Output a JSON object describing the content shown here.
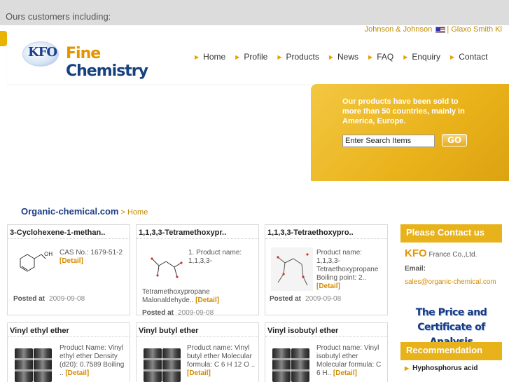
{
  "top": {
    "customers_label": "Ours customers including:",
    "customers": [
      "Johnson & Johnson",
      "|",
      "Glaxo Smith Kl"
    ]
  },
  "logo": {
    "badge": "KFO",
    "word1": "Fine",
    "word2": "Chemistry"
  },
  "nav": {
    "items": [
      "Home",
      "Profile",
      "Products",
      "News",
      "FAQ",
      "Enquiry",
      "Contact"
    ]
  },
  "promo": {
    "text": "Our products have been sold to more than 50 countries, mainly in America, Europe.",
    "search_value": "Enter Search Items",
    "go_label": "GO"
  },
  "breadcrumb": {
    "site": "Organic-chemical.com",
    "sep": " > ",
    "current": "Home"
  },
  "products": [
    {
      "title": "3-Cyclohexene-1-methan..",
      "desc": "CAS No.: 1679-51-2",
      "detail": "[Detail]",
      "posted_label": "Posted at",
      "date": "2009-09-08"
    },
    {
      "title": "1,1,3,3-Tetramethoxypr..",
      "desc_top": "1. Product name: 1,1,3,3-",
      "desc_bottom": "Tetramethoxypropane Malonaldehyde..",
      "detail": "[Detail]",
      "posted_label": "Posted at",
      "date": "2009-09-08"
    },
    {
      "title": "1,1,3,3-Tetraethoxypro..",
      "desc": "Product name: 1,1,3,3-Tetraethoxypropane Boiling point: 2..",
      "detail": "[Detail]",
      "posted_label": "Posted at",
      "date": "2009-09-08"
    },
    {
      "title": "Vinyl ethyl ether",
      "desc": "Product Name: Vinyl ethyl ether Density (d20): 0.7589 Boiling ..",
      "detail": "[Detail]"
    },
    {
      "title": "Vinyl butyl ether",
      "desc": "Product name: Vinyl butyl ether Molecular formula: C 6 H 12 O ..",
      "detail": "[Detail]"
    },
    {
      "title": "Vinyl isobutyl ether",
      "desc": "Product name: Vinyl isobutyl ether Molecular formula: C 6 H..",
      "detail": "[Detail]"
    }
  ],
  "sidebar": {
    "contact_header": "Please Contact us",
    "company_kfo": "KFO",
    "company_rest": "France Co.,Ltd.",
    "email_label": "Email:",
    "email": "sales@organic-chemical.com",
    "price_banner_line1": "The Price and",
    "price_banner_line2": "Certificate of Analysis",
    "rec_header": "Recommendation",
    "rec_items": [
      "Hyphosphorus acid"
    ]
  },
  "colors": {
    "accent": "#e7b21a",
    "brand_blue": "#16407f",
    "link_orange": "#d48a00"
  }
}
